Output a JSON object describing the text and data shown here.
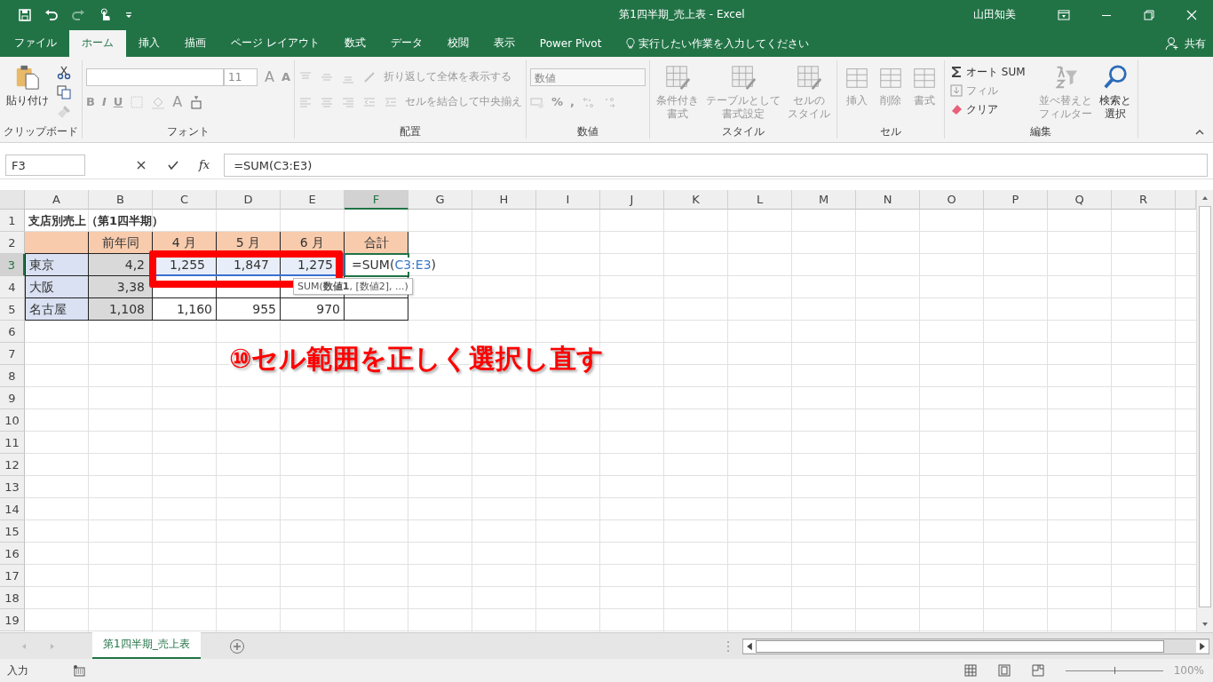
{
  "window": {
    "title": "第1四半期_売上表  -  Excel",
    "user": "山田知美"
  },
  "tabs": [
    {
      "label": "ファイル",
      "selected": false
    },
    {
      "label": "ホーム",
      "selected": true
    },
    {
      "label": "挿入",
      "selected": false
    },
    {
      "label": "描画",
      "selected": false
    },
    {
      "label": "ページ レイアウト",
      "selected": false
    },
    {
      "label": "数式",
      "selected": false
    },
    {
      "label": "データ",
      "selected": false
    },
    {
      "label": "校閲",
      "selected": false
    },
    {
      "label": "表示",
      "selected": false
    },
    {
      "label": "Power Pivot",
      "selected": false
    }
  ],
  "tell_me": "実行したい作業を入力してください",
  "share": "共有",
  "ribbon": {
    "clipboard": {
      "label": "クリップボード",
      "paste": "貼り付け"
    },
    "font": {
      "label": "フォント",
      "size": "11",
      "grow": "A",
      "shrink": "A",
      "styles": [
        "B",
        "I",
        "U"
      ],
      "font_color_letter": "A"
    },
    "alignment": {
      "label": "配置",
      "wrap": "折り返して全体を表示する",
      "merge": "セルを結合して中央揃え"
    },
    "number": {
      "label": "数値",
      "format": "数値",
      "symbols": [
        "%",
        ","
      ]
    },
    "styles": {
      "label": "スタイル",
      "items": [
        {
          "lines": [
            "条件付き",
            "書式"
          ],
          "disabled": true
        },
        {
          "lines": [
            "テーブルとして",
            "書式設定"
          ],
          "disabled": true
        },
        {
          "lines": [
            "セルの",
            "スタイル"
          ],
          "disabled": true
        }
      ]
    },
    "cells": {
      "label": "セル",
      "items": [
        {
          "lines": [
            "挿入"
          ],
          "disabled": true
        },
        {
          "lines": [
            "削除"
          ],
          "disabled": true
        },
        {
          "lines": [
            "書式"
          ],
          "disabled": true
        }
      ]
    },
    "editing": {
      "label": "編集",
      "small": [
        {
          "label": "オート SUM",
          "disabled": false
        },
        {
          "label": "フィル",
          "disabled": true
        },
        {
          "label": "クリア",
          "disabled": false
        }
      ],
      "large": [
        {
          "lines": [
            "並べ替えと",
            "フィルター"
          ],
          "disabled": true
        },
        {
          "lines": [
            "検索と",
            "選択"
          ],
          "disabled": false
        }
      ]
    }
  },
  "formula_bar": {
    "name_box": "F3",
    "fx": "fx",
    "formula": "=SUM(C3:E3)"
  },
  "columns": [
    {
      "label": "A",
      "selected": false
    },
    {
      "label": "B",
      "selected": false
    },
    {
      "label": "C",
      "selected": false
    },
    {
      "label": "D",
      "selected": false
    },
    {
      "label": "E",
      "selected": false
    },
    {
      "label": "F",
      "selected": true
    },
    {
      "label": "G",
      "selected": false
    },
    {
      "label": "H",
      "selected": false
    },
    {
      "label": "I",
      "selected": false
    },
    {
      "label": "J",
      "selected": false
    },
    {
      "label": "K",
      "selected": false
    },
    {
      "label": "L",
      "selected": false
    },
    {
      "label": "M",
      "selected": false
    },
    {
      "label": "N",
      "selected": false
    },
    {
      "label": "O",
      "selected": false
    },
    {
      "label": "P",
      "selected": false
    },
    {
      "label": "Q",
      "selected": false
    },
    {
      "label": "R",
      "selected": false
    }
  ],
  "rows": [
    {
      "label": "1",
      "selected": false,
      "cells": [
        {
          "kind": "title",
          "text": "支店別売上（第1四半期）"
        }
      ]
    },
    {
      "label": "2",
      "selected": false,
      "cells": [
        {
          "kind": "header"
        },
        {
          "kind": "header",
          "text": "前年同"
        },
        {
          "kind": "header",
          "text": "4 月"
        },
        {
          "kind": "header",
          "text": "5 月"
        },
        {
          "kind": "header",
          "text": "6 月"
        },
        {
          "kind": "header",
          "text": "合計"
        }
      ]
    },
    {
      "label": "3",
      "selected": true,
      "cells": [
        {
          "kind": "label",
          "text": "東京"
        },
        {
          "kind": "prior",
          "text": "4,2"
        },
        {
          "kind": "number",
          "text": "1,255",
          "selected": true
        },
        {
          "kind": "number",
          "text": "1,847",
          "selected": true
        },
        {
          "kind": "number",
          "text": "1,275",
          "selected": true
        },
        {
          "kind": "editing",
          "prefix": "=SUM(",
          "ref": "C3:E3",
          "suffix": ")"
        }
      ]
    },
    {
      "label": "4",
      "selected": false,
      "cells": [
        {
          "kind": "label",
          "text": "大阪"
        },
        {
          "kind": "prior",
          "text": "3,38"
        },
        {
          "kind": "number",
          "selected": false
        },
        {
          "kind": "number",
          "selected": false
        },
        {
          "kind": "number",
          "selected": false
        },
        {
          "kind": "number",
          "selected": false
        }
      ]
    },
    {
      "label": "5",
      "selected": false,
      "cells": [
        {
          "kind": "label",
          "text": "名古屋"
        },
        {
          "kind": "prior",
          "text": "1,108"
        },
        {
          "kind": "number",
          "text": "1,160",
          "selected": false
        },
        {
          "kind": "number",
          "text": "955",
          "selected": false
        },
        {
          "kind": "number",
          "text": "970",
          "selected": false
        },
        {
          "kind": "number",
          "selected": false
        }
      ]
    },
    {
      "label": "6",
      "selected": false,
      "cells": []
    },
    {
      "label": "7",
      "selected": false,
      "cells": []
    },
    {
      "label": "8",
      "selected": false,
      "cells": []
    },
    {
      "label": "9",
      "selected": false,
      "cells": []
    },
    {
      "label": "10",
      "selected": false,
      "cells": []
    },
    {
      "label": "11",
      "selected": false,
      "cells": []
    },
    {
      "label": "12",
      "selected": false,
      "cells": []
    },
    {
      "label": "13",
      "selected": false,
      "cells": []
    },
    {
      "label": "14",
      "selected": false,
      "cells": []
    },
    {
      "label": "15",
      "selected": false,
      "cells": []
    },
    {
      "label": "16",
      "selected": false,
      "cells": []
    },
    {
      "label": "17",
      "selected": false,
      "cells": []
    },
    {
      "label": "18",
      "selected": false,
      "cells": []
    },
    {
      "label": "19",
      "selected": false,
      "cells": []
    }
  ],
  "tooltip": "SUM(**数値1**, [数値2], ...)",
  "annotation": "⑩セル範囲を正しく選択し直す",
  "sheet_tabs": [
    {
      "label": "第1四半期_売上表",
      "selected": true
    }
  ],
  "status_bar": {
    "mode": "入力",
    "zoom_slider": {
      "level": 0.5
    },
    "zoom": "100%"
  }
}
